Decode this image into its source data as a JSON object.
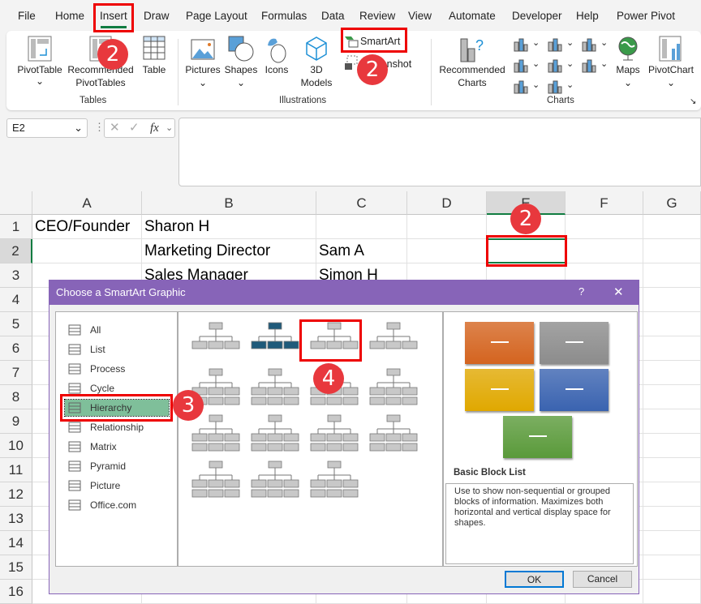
{
  "tabs": [
    "File",
    "Home",
    "Insert",
    "Draw",
    "Page Layout",
    "Formulas",
    "Data",
    "Review",
    "View",
    "Automate",
    "Developer",
    "Help",
    "Power Pivot"
  ],
  "active_tab": "Insert",
  "ribbon": {
    "tables": {
      "label": "Tables",
      "pivottable": "PivotTable",
      "recommended_pivottables": [
        "Recommended",
        "PivotTables"
      ],
      "table": "Table"
    },
    "illustrations": {
      "label": "Illustrations",
      "pictures": "Pictures",
      "shapes": "Shapes",
      "icons": "Icons",
      "models": [
        "3D",
        "Models"
      ],
      "smartart": "SmartArt",
      "screenshot": "Screenshot"
    },
    "charts": {
      "label": "Charts",
      "recommended_charts": [
        "Recommended",
        "Charts"
      ],
      "maps": "Maps",
      "pivotchart": "PivotChart"
    }
  },
  "formula_bar": {
    "name_box": "E2",
    "fx": "fx",
    "value": ""
  },
  "columns": [
    "A",
    "B",
    "C",
    "D",
    "E",
    "F",
    "G"
  ],
  "rows": [
    "1",
    "2",
    "3",
    "4",
    "5",
    "6",
    "7",
    "8",
    "9",
    "10",
    "11",
    "12",
    "13",
    "14",
    "15",
    "16"
  ],
  "cells": {
    "A1": "CEO/Founder",
    "B1": "Sharon H",
    "B2": "Marketing Director",
    "C2": "Sam A",
    "B3": "Sales Manager",
    "C3": "Simon H"
  },
  "selected_cell": "E2",
  "dialog": {
    "title": "Choose a SmartArt Graphic",
    "help": "?",
    "close": "✕",
    "categories": [
      "All",
      "List",
      "Process",
      "Cycle",
      "Hierarchy",
      "Relationship",
      "Matrix",
      "Pyramid",
      "Picture",
      "Office.com"
    ],
    "selected_category": "Hierarchy",
    "preview_title": "Basic Block List",
    "preview_description": "Use to show non-sequential or grouped blocks of information. Maximizes both horizontal and vertical display space for shapes.",
    "preview_colors": [
      "#d4641f",
      "#8c8c8c",
      "#e0a800",
      "#3a63b0",
      "#5a9a3a"
    ],
    "ok": "OK",
    "cancel": "Cancel"
  },
  "annotations": [
    "2",
    "2",
    "2",
    "3",
    "4"
  ],
  "colors": {
    "accent": "#8764b8",
    "annotation": "#e8383d",
    "hierarchy_highlight": "#7fbf9a",
    "excel_green": "#107c41"
  }
}
